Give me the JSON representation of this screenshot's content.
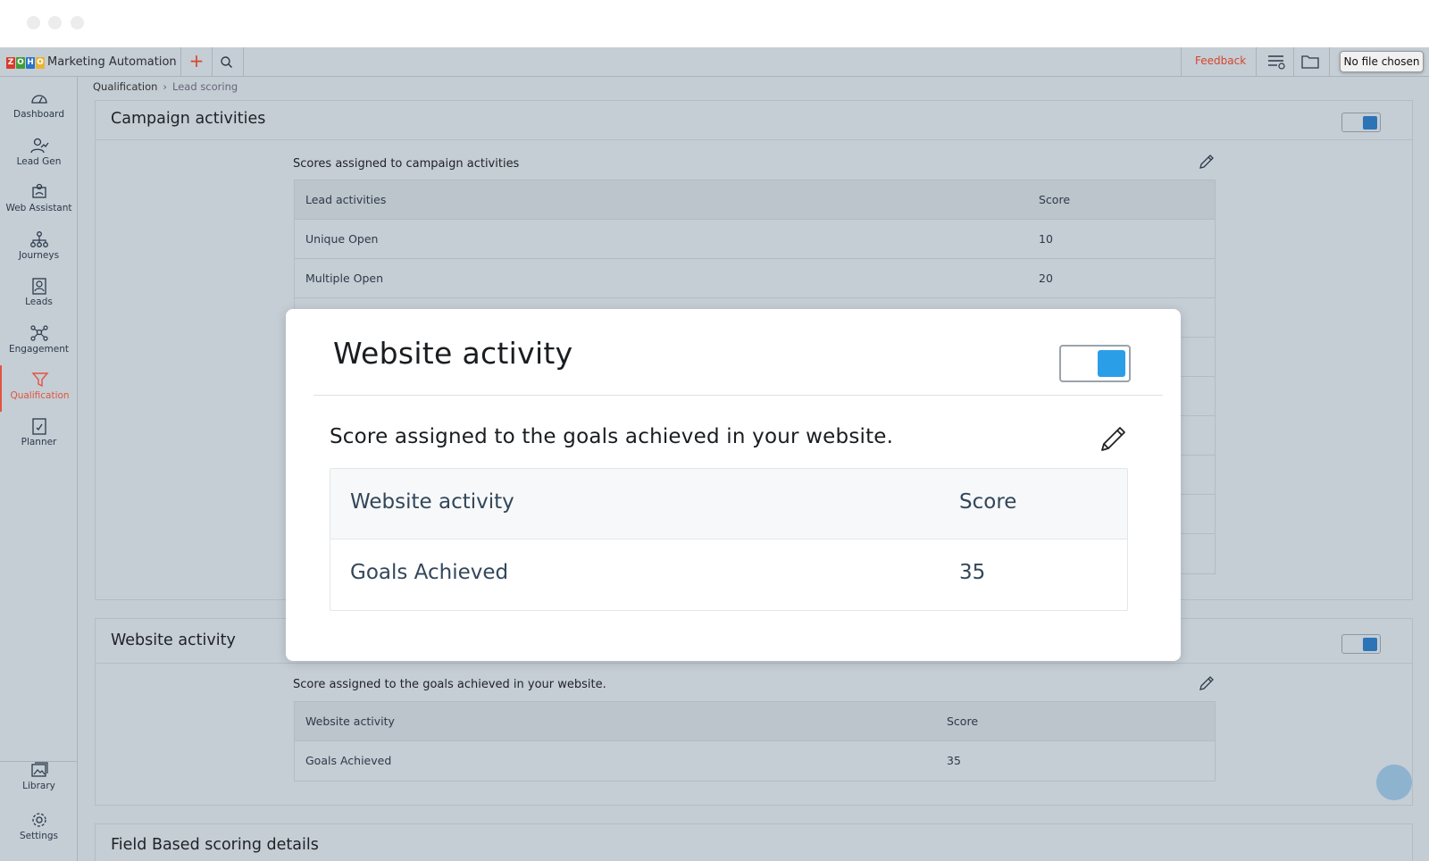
{
  "app": {
    "title": "Marketing Automation",
    "logo_letters": [
      "Z",
      "O",
      "H",
      "O"
    ],
    "logo_colors": [
      "#d93b2b",
      "#3f9d3a",
      "#2b74c6",
      "#e8b534"
    ]
  },
  "topbar": {
    "feedback_label": "Feedback",
    "file_tooltip": "No file chosen",
    "icons": [
      "add-icon",
      "search-icon",
      "list-filter-icon",
      "folder-icon"
    ]
  },
  "sidebar": {
    "items": [
      {
        "label": "Dashboard",
        "icon": "dashboard-icon"
      },
      {
        "label": "Lead Gen",
        "icon": "lead-gen-icon"
      },
      {
        "label": "Web Assistant",
        "icon": "web-assistant-icon"
      },
      {
        "label": "Journeys",
        "icon": "journeys-icon"
      },
      {
        "label": "Leads",
        "icon": "leads-icon"
      },
      {
        "label": "Engagement",
        "icon": "engagement-icon"
      },
      {
        "label": "Qualification",
        "icon": "funnel-icon",
        "active": true
      },
      {
        "label": "Planner",
        "icon": "planner-icon"
      }
    ],
    "bottom_items": [
      {
        "label": "Library",
        "icon": "library-icon"
      },
      {
        "label": "Settings",
        "icon": "settings-icon"
      }
    ]
  },
  "breadcrumb": {
    "parent": "Qualification",
    "current": "Lead scoring"
  },
  "campaign_card": {
    "title": "Campaign activities",
    "toggle_on": true,
    "description": "Scores assigned to campaign activities",
    "columns": [
      "Lead activities",
      "Score"
    ],
    "rows": [
      {
        "activity": "Unique Open",
        "score": "10"
      },
      {
        "activity": "Multiple Open",
        "score": "20"
      }
    ]
  },
  "website_card": {
    "title": "Website activity",
    "toggle_on": true,
    "description": "Score assigned to the goals achieved in your website.",
    "columns": [
      "Website activity",
      "Score"
    ],
    "rows": [
      {
        "activity": "Goals Achieved",
        "score": "35"
      }
    ]
  },
  "field_card": {
    "title": "Field Based scoring details"
  },
  "modal": {
    "title": "Website activity",
    "toggle_on": true,
    "description": "Score assigned to the goals achieved in your website.",
    "columns": [
      "Website activity",
      "Score"
    ],
    "rows": [
      {
        "activity": "Goals Achieved",
        "score": "35"
      }
    ]
  },
  "colors": {
    "accent": "#e0553f",
    "toggle_blue": "#2b9ee8",
    "overlay_bg": "#c4ccd4"
  }
}
